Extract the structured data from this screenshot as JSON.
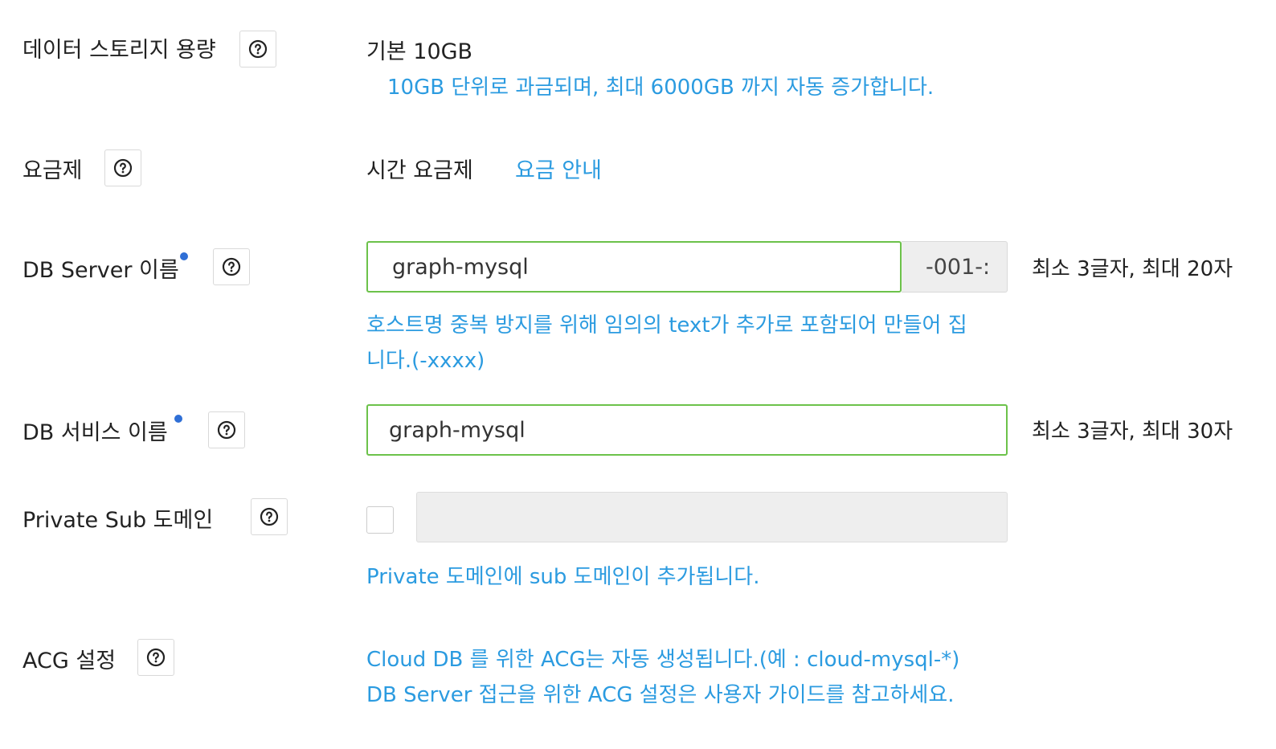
{
  "storage": {
    "label": "데이터 스토리지 용량",
    "value": "기본 10GB",
    "note": "10GB 단위로 과금되며, 최대 6000GB 까지 자동 증가합니다."
  },
  "pricing": {
    "label": "요금제",
    "value": "시간 요금제",
    "link": "요금 안내"
  },
  "server_name": {
    "label": "DB Server 이름",
    "value": "graph-mysql",
    "suffix": "-001-:",
    "constraint": "최소 3글자, 최대 20자",
    "note_line1": "호스트명 중복 방지를 위해 임의의 text가 추가로 포함되어 만들어 집",
    "note_line2": "니다.(-xxxx)"
  },
  "service_name": {
    "label": "DB 서비스 이름",
    "value": "graph-mysql",
    "constraint": "최소 3글자, 최대 30자"
  },
  "private_sub": {
    "label": "Private Sub 도메인",
    "note": "Private 도메인에 sub 도메인이 추가됩니다."
  },
  "acg": {
    "label": "ACG 설정",
    "note_line1": "Cloud DB 를 위한 ACG는 자동 생성됩니다.(예 : cloud-mysql-*)",
    "note_line2": "DB Server 접근을 위한 ACG 설정은 사용자 가이드를 참고하세요."
  },
  "colors": {
    "accent_blue": "#2b9be0",
    "valid_green": "#6cc24a",
    "required_dot": "#2f6fd6"
  },
  "icons": {
    "help": "question-circle-icon"
  }
}
